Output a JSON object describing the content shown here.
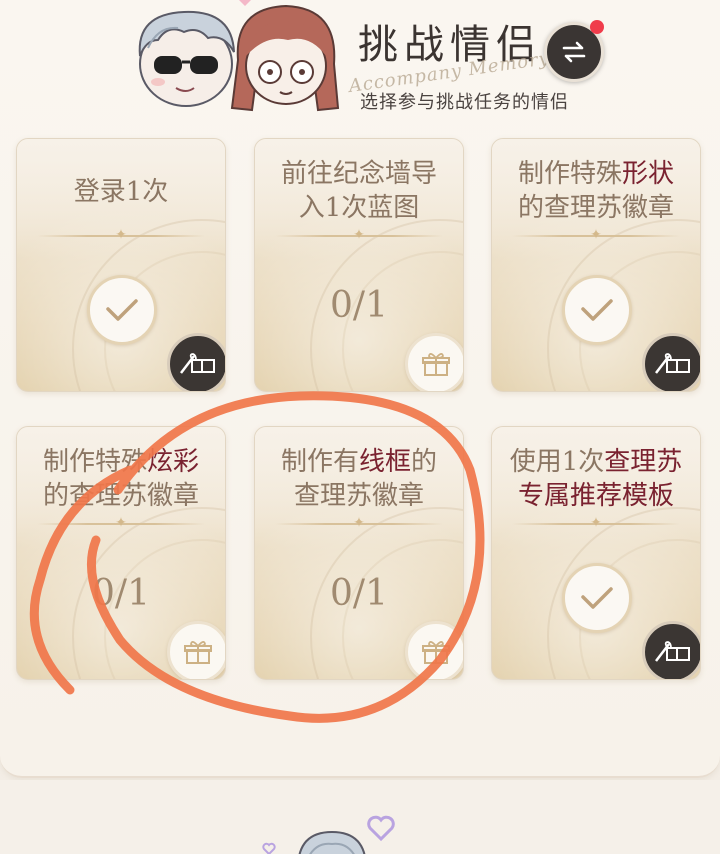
{
  "header": {
    "title": "挑战情侣",
    "script_title": "Accompany Memory",
    "subtitle": "选择参与挑战任务的情侣",
    "switch_icon": "swap-arrows-icon",
    "badge_color": "#f03c4b"
  },
  "tasks": [
    {
      "text_parts": [
        "登录1次"
      ],
      "highlight": "",
      "state": "completed",
      "progress": ""
    },
    {
      "text_parts": [
        "前往纪念墙导",
        "入1次蓝图"
      ],
      "highlight": "",
      "state": "pending",
      "progress": "0/1"
    },
    {
      "line1_pre": "制作特殊",
      "line1_hl": "形状",
      "line2": "的查理苏徽章",
      "state": "completed",
      "progress": ""
    },
    {
      "line1_pre": "制作特殊",
      "line1_hl": "炫彩",
      "line2": "的查理苏徽章",
      "state": "pending",
      "progress": "0/1"
    },
    {
      "line1_pre": "制作有",
      "line1_hl": "线框",
      "line1_post": "的",
      "line2": "查理苏徽章",
      "state": "pending",
      "progress": "0/1"
    },
    {
      "line1_pre": "使用1次",
      "line1_hl": "查理苏",
      "line2": "专属推荐模板",
      "state": "completed",
      "progress": ""
    }
  ],
  "colors": {
    "highlight": "#7a2230",
    "annotation": "#f0764a"
  }
}
